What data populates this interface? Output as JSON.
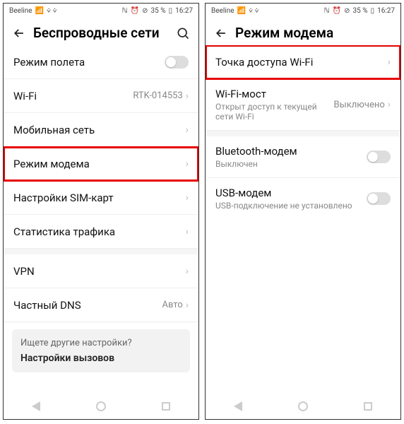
{
  "status": {
    "carrier": "Beeline",
    "battery": "35 %",
    "time": "16:27"
  },
  "left": {
    "title": "Беспроводные сети",
    "items": {
      "airplane": {
        "label": "Режим полета"
      },
      "wifi": {
        "label": "Wi-Fi",
        "value": "RTK-014553"
      },
      "mobile": {
        "label": "Мобильная сеть"
      },
      "tether": {
        "label": "Режим модема"
      },
      "sim": {
        "label": "Настройки SIM-карт"
      },
      "traffic": {
        "label": "Статистика трафика"
      },
      "vpn": {
        "label": "VPN"
      },
      "dns": {
        "label": "Частный DNS",
        "value": "Авто"
      }
    },
    "footer": {
      "question": "Ищете другие настройки?",
      "link": "Настройки вызовов"
    }
  },
  "right": {
    "title": "Режим модема",
    "items": {
      "hotspot": {
        "label": "Точка доступа Wi-Fi"
      },
      "bridge": {
        "label": "Wi-Fi-мост",
        "sub": "Открыт доступ к текущей сети Wi-Fi",
        "value": "Выключено"
      },
      "bt": {
        "label": "Bluetooth-модем",
        "sub": "Выключен"
      },
      "usb": {
        "label": "USB-модем",
        "sub": "USB-подключение не установлено"
      }
    }
  }
}
